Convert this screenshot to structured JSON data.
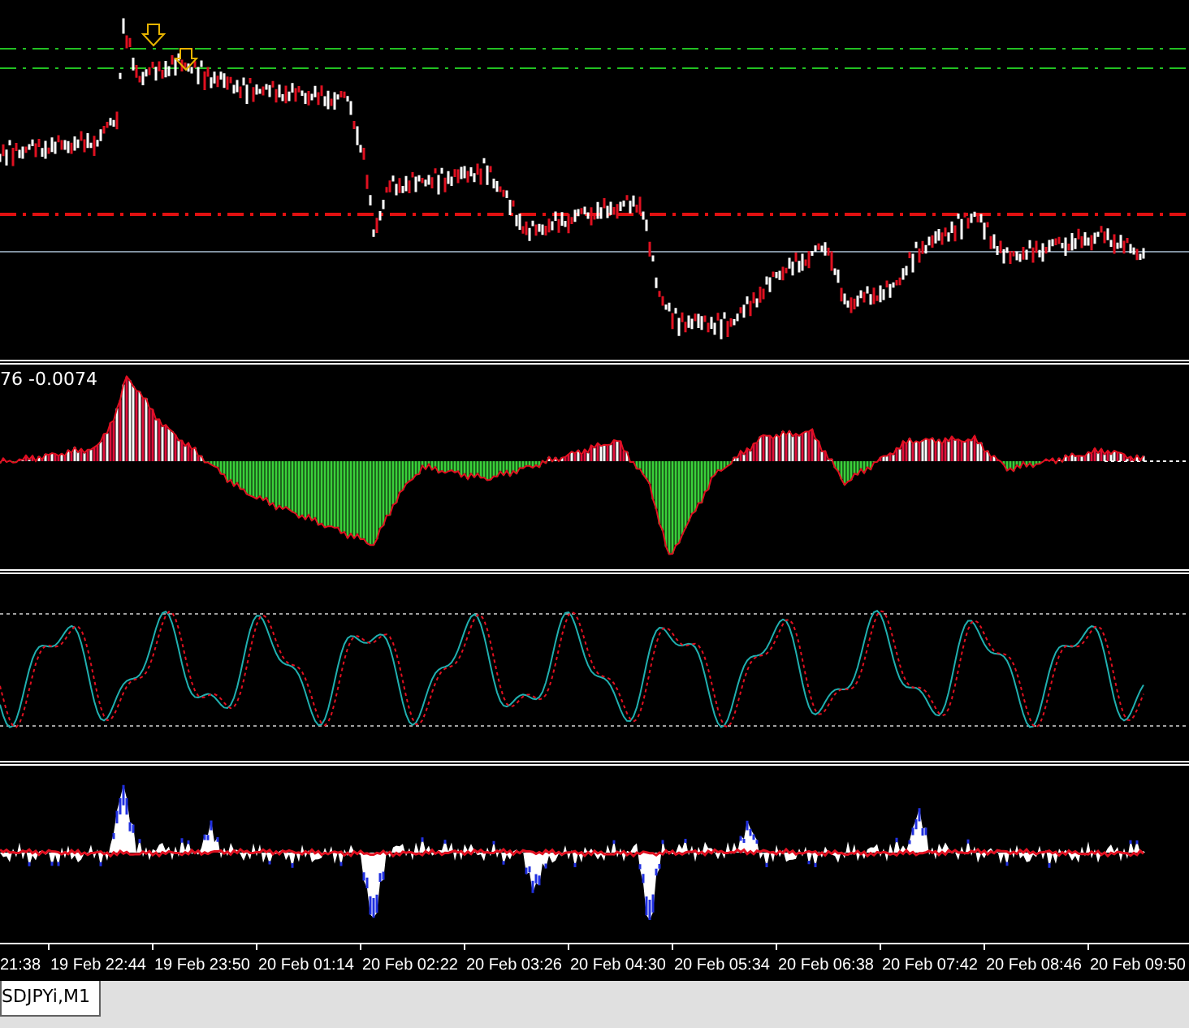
{
  "indicator_readout": "76 -0.0074",
  "time_axis": {
    "labels": [
      "21:38",
      "19 Feb 22:44",
      "19 Feb 23:50",
      "20 Feb 01:14",
      "20 Feb 02:22",
      "20 Feb 03:26",
      "20 Feb 04:30",
      "20 Feb 05:34",
      "20 Feb 06:38",
      "20 Feb 07:42",
      "20 Feb 08:46",
      "20 Feb 09:50"
    ]
  },
  "tabs": [
    {
      "label": "SDJPYi,M1",
      "selected": true
    }
  ]
}
